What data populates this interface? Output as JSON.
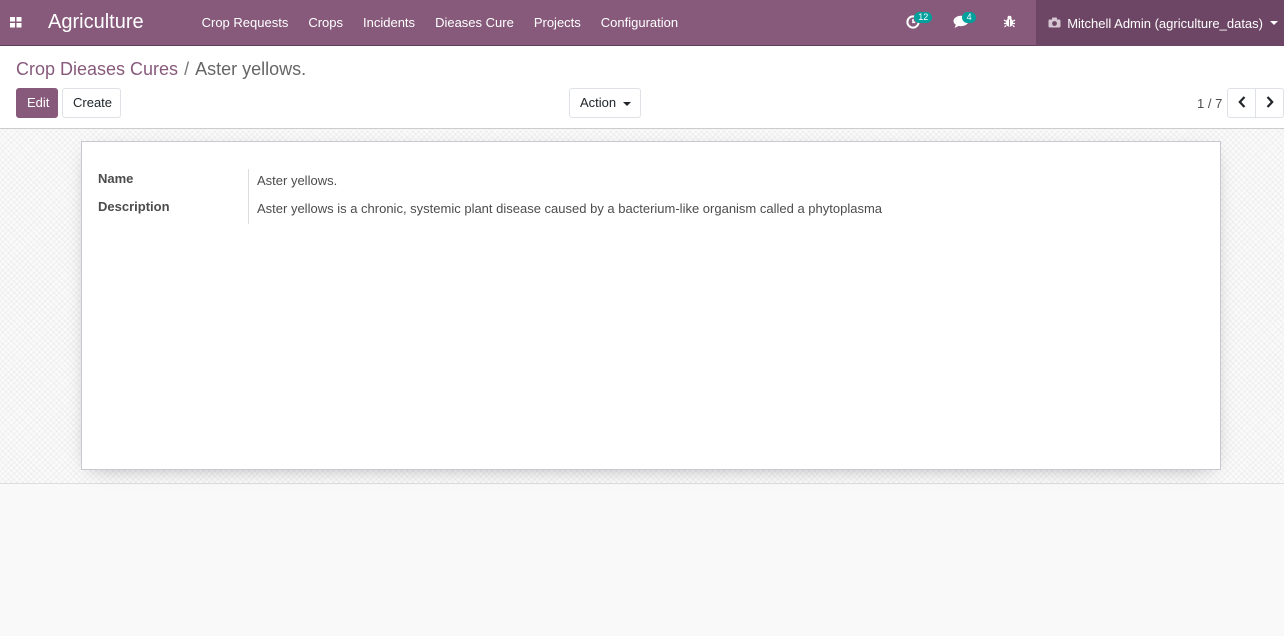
{
  "navbar": {
    "brand": "Agriculture",
    "menu": [
      {
        "label": "Crop Requests"
      },
      {
        "label": "Crops"
      },
      {
        "label": "Incidents"
      },
      {
        "label": "Dieases Cure"
      },
      {
        "label": "Projects"
      },
      {
        "label": "Configuration"
      }
    ],
    "activity_count": "12",
    "messages_count": "4",
    "user_name": "Mitchell Admin (agriculture_datas)"
  },
  "breadcrumb": {
    "parent": "Crop Dieases Cures",
    "separator": "/",
    "current": "Aster yellows."
  },
  "buttons": {
    "edit": "Edit",
    "create": "Create",
    "action": "Action"
  },
  "pager": {
    "value": "1 / 7"
  },
  "form": {
    "name_label": "Name",
    "name_value": "Aster yellows.",
    "description_label": "Description",
    "description_value": "Aster yellows is a chronic, systemic plant disease caused by a bacterium-like organism called a phytoplasma"
  },
  "colors": {
    "brand": "#875a7b",
    "user_menu_bg": "#6c4664",
    "badge": "#00a09d"
  },
  "icons": {
    "apps": "apps-grid-icon",
    "activity": "clock-icon",
    "messages": "chat-icon",
    "debug": "bug-icon",
    "avatar": "camera-icon",
    "prev": "chevron-left-icon",
    "next": "chevron-right-icon"
  }
}
